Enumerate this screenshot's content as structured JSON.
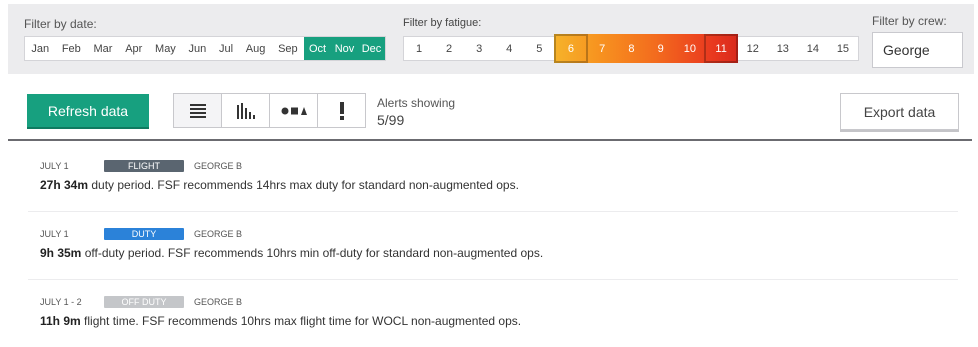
{
  "filters": {
    "date_label": "Filter by date:",
    "months": [
      {
        "label": "Jan",
        "selected": false
      },
      {
        "label": "Feb",
        "selected": false
      },
      {
        "label": "Mar",
        "selected": false
      },
      {
        "label": "Apr",
        "selected": false
      },
      {
        "label": "May",
        "selected": false
      },
      {
        "label": "Jun",
        "selected": false
      },
      {
        "label": "Jul",
        "selected": false
      },
      {
        "label": "Aug",
        "selected": false
      },
      {
        "label": "Sep",
        "selected": false
      },
      {
        "label": "Oct",
        "selected": true
      },
      {
        "label": "Nov",
        "selected": true
      },
      {
        "label": "Dec",
        "selected": true
      }
    ],
    "fatigue_label": "Filter by fatigue:",
    "fatigue_levels": [
      "1",
      "2",
      "3",
      "4",
      "5",
      "6",
      "7",
      "8",
      "9",
      "10",
      "11",
      "12",
      "13",
      "14",
      "15"
    ],
    "fatigue_selected_range": [
      6,
      11
    ],
    "crew_label": "Filter by crew:",
    "crew_value": "George"
  },
  "toolbar": {
    "refresh_label": "Refresh data",
    "views": [
      {
        "icon": "list-icon",
        "active": true
      },
      {
        "icon": "bar-chart-icon",
        "active": false
      },
      {
        "icon": "shapes-icon",
        "active": false
      },
      {
        "icon": "alert-icon",
        "active": false
      }
    ],
    "alerts_label": "Alerts showing",
    "alerts_count": "5/99",
    "export_label": "Export data"
  },
  "colors": {
    "accent": "#17a07f",
    "flight": "#5a6570",
    "duty": "#2b82d9",
    "off_duty": "#c4c6c9"
  },
  "alerts": [
    {
      "date": "JULY 1",
      "type": "FLIGHT",
      "type_color": "#5a6570",
      "crew": "GEORGE B",
      "value": "27h 34m",
      "text": " duty period. FSF recommends 14hrs max duty for standard non-augmented ops."
    },
    {
      "date": "JULY 1",
      "type": "DUTY",
      "type_color": "#2b82d9",
      "crew": "GEORGE B",
      "value": "9h 35m",
      "text": " off-duty period. FSF recommends 10hrs min off-duty for standard non-augmented ops."
    },
    {
      "date": "JULY 1 - 2",
      "type": "OFF DUTY",
      "type_color": "#c4c6c9",
      "crew": "GEORGE B",
      "value": "11h 9m",
      "text": " flight time. FSF recommends 10hrs max flight time for WOCL non-augmented ops."
    }
  ]
}
